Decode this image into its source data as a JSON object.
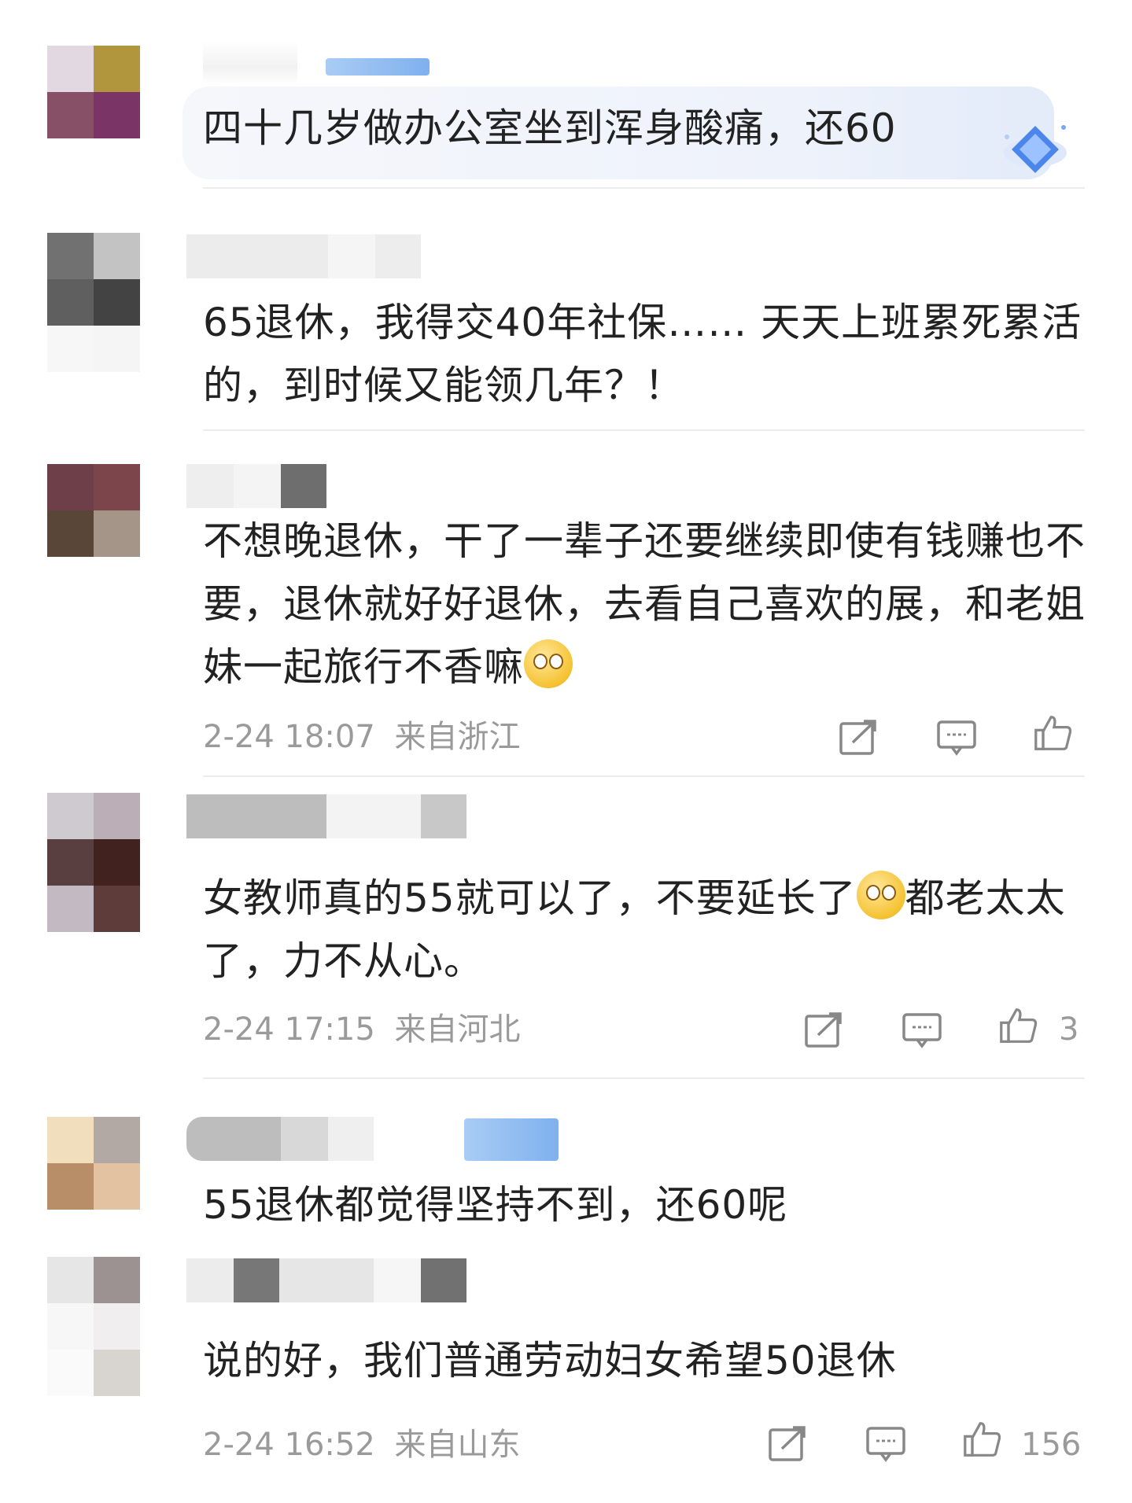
{
  "comments": [
    {
      "text": "四十几岁做办公室坐到浑身酸痛，还60",
      "time": "",
      "location": "",
      "likes": ""
    },
    {
      "text": "65退休，我得交40年社保…… 天天上班累死累活的，到时候又能领几年？！",
      "time": "",
      "location": "",
      "likes": ""
    },
    {
      "text": "不想晚退休，干了一辈子还要继续即使有钱赚也不要，退休就好好退休，去看自己喜欢的展，和老姐妹一起旅行不香嘛",
      "time": "2-24 18:07",
      "location": "来自浙江",
      "likes": ""
    },
    {
      "text_a": "女教师真的55就可以了，不要延长了",
      "text_b": "都老太太了，力不从心。",
      "time": "2-24 17:15",
      "location": "来自河北",
      "likes": "3"
    },
    {
      "text": "55退休都觉得坚持不到，还60呢",
      "time": "",
      "location": "",
      "likes": ""
    },
    {
      "text": "说的好，我们普通劳动妇女希望50退休",
      "time": "2-24 16:52",
      "location": "来自山东",
      "likes": "156"
    }
  ],
  "icons": {
    "share": "share-icon",
    "reply": "comment-icon",
    "like": "thumbs-up-icon"
  },
  "colors": {
    "text": "#222222",
    "meta": "#9a9a9a",
    "badge": "#7fb1ee"
  }
}
